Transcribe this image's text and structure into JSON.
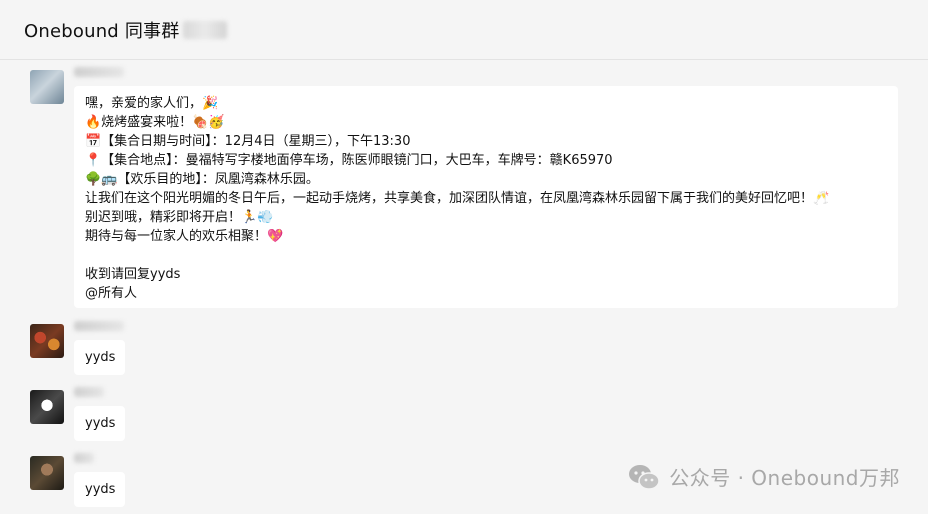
{
  "header": {
    "title": "Onebound 同事群"
  },
  "message1": {
    "lines": [
      "嘿，亲爱的家人们，🎉",
      "🔥烧烤盛宴来啦！🍖🥳",
      "📅【集合日期与时间】：12月4日（星期三），下午13:30",
      "📍【集合地点】：曼福特写字楼地面停车场，陈医师眼镜门口，大巴车，车牌号：赣K65970",
      "🌳🚌【欢乐目的地】：凤凰湾森林乐园。",
      "让我们在这个阳光明媚的冬日午后，一起动手烧烤，共享美食，加深团队情谊，在凤凰湾森林乐园留下属于我们的美好回忆吧！🥂",
      "别迟到哦，精彩即将开启！🏃💨",
      "期待与每一位家人的欢乐相聚！💖",
      "",
      "收到请回复yyds",
      "@所有人"
    ]
  },
  "reply1": {
    "text": "yyds"
  },
  "reply2": {
    "text": "yyds"
  },
  "reply3": {
    "text": "yyds"
  },
  "watermark": {
    "text": "公众号 · Onebound万邦",
    "icon": "wechat-icon"
  },
  "colors": {
    "background": "#f5f5f5",
    "bubble": "#ffffff",
    "watermark": "#a8a8a8"
  }
}
